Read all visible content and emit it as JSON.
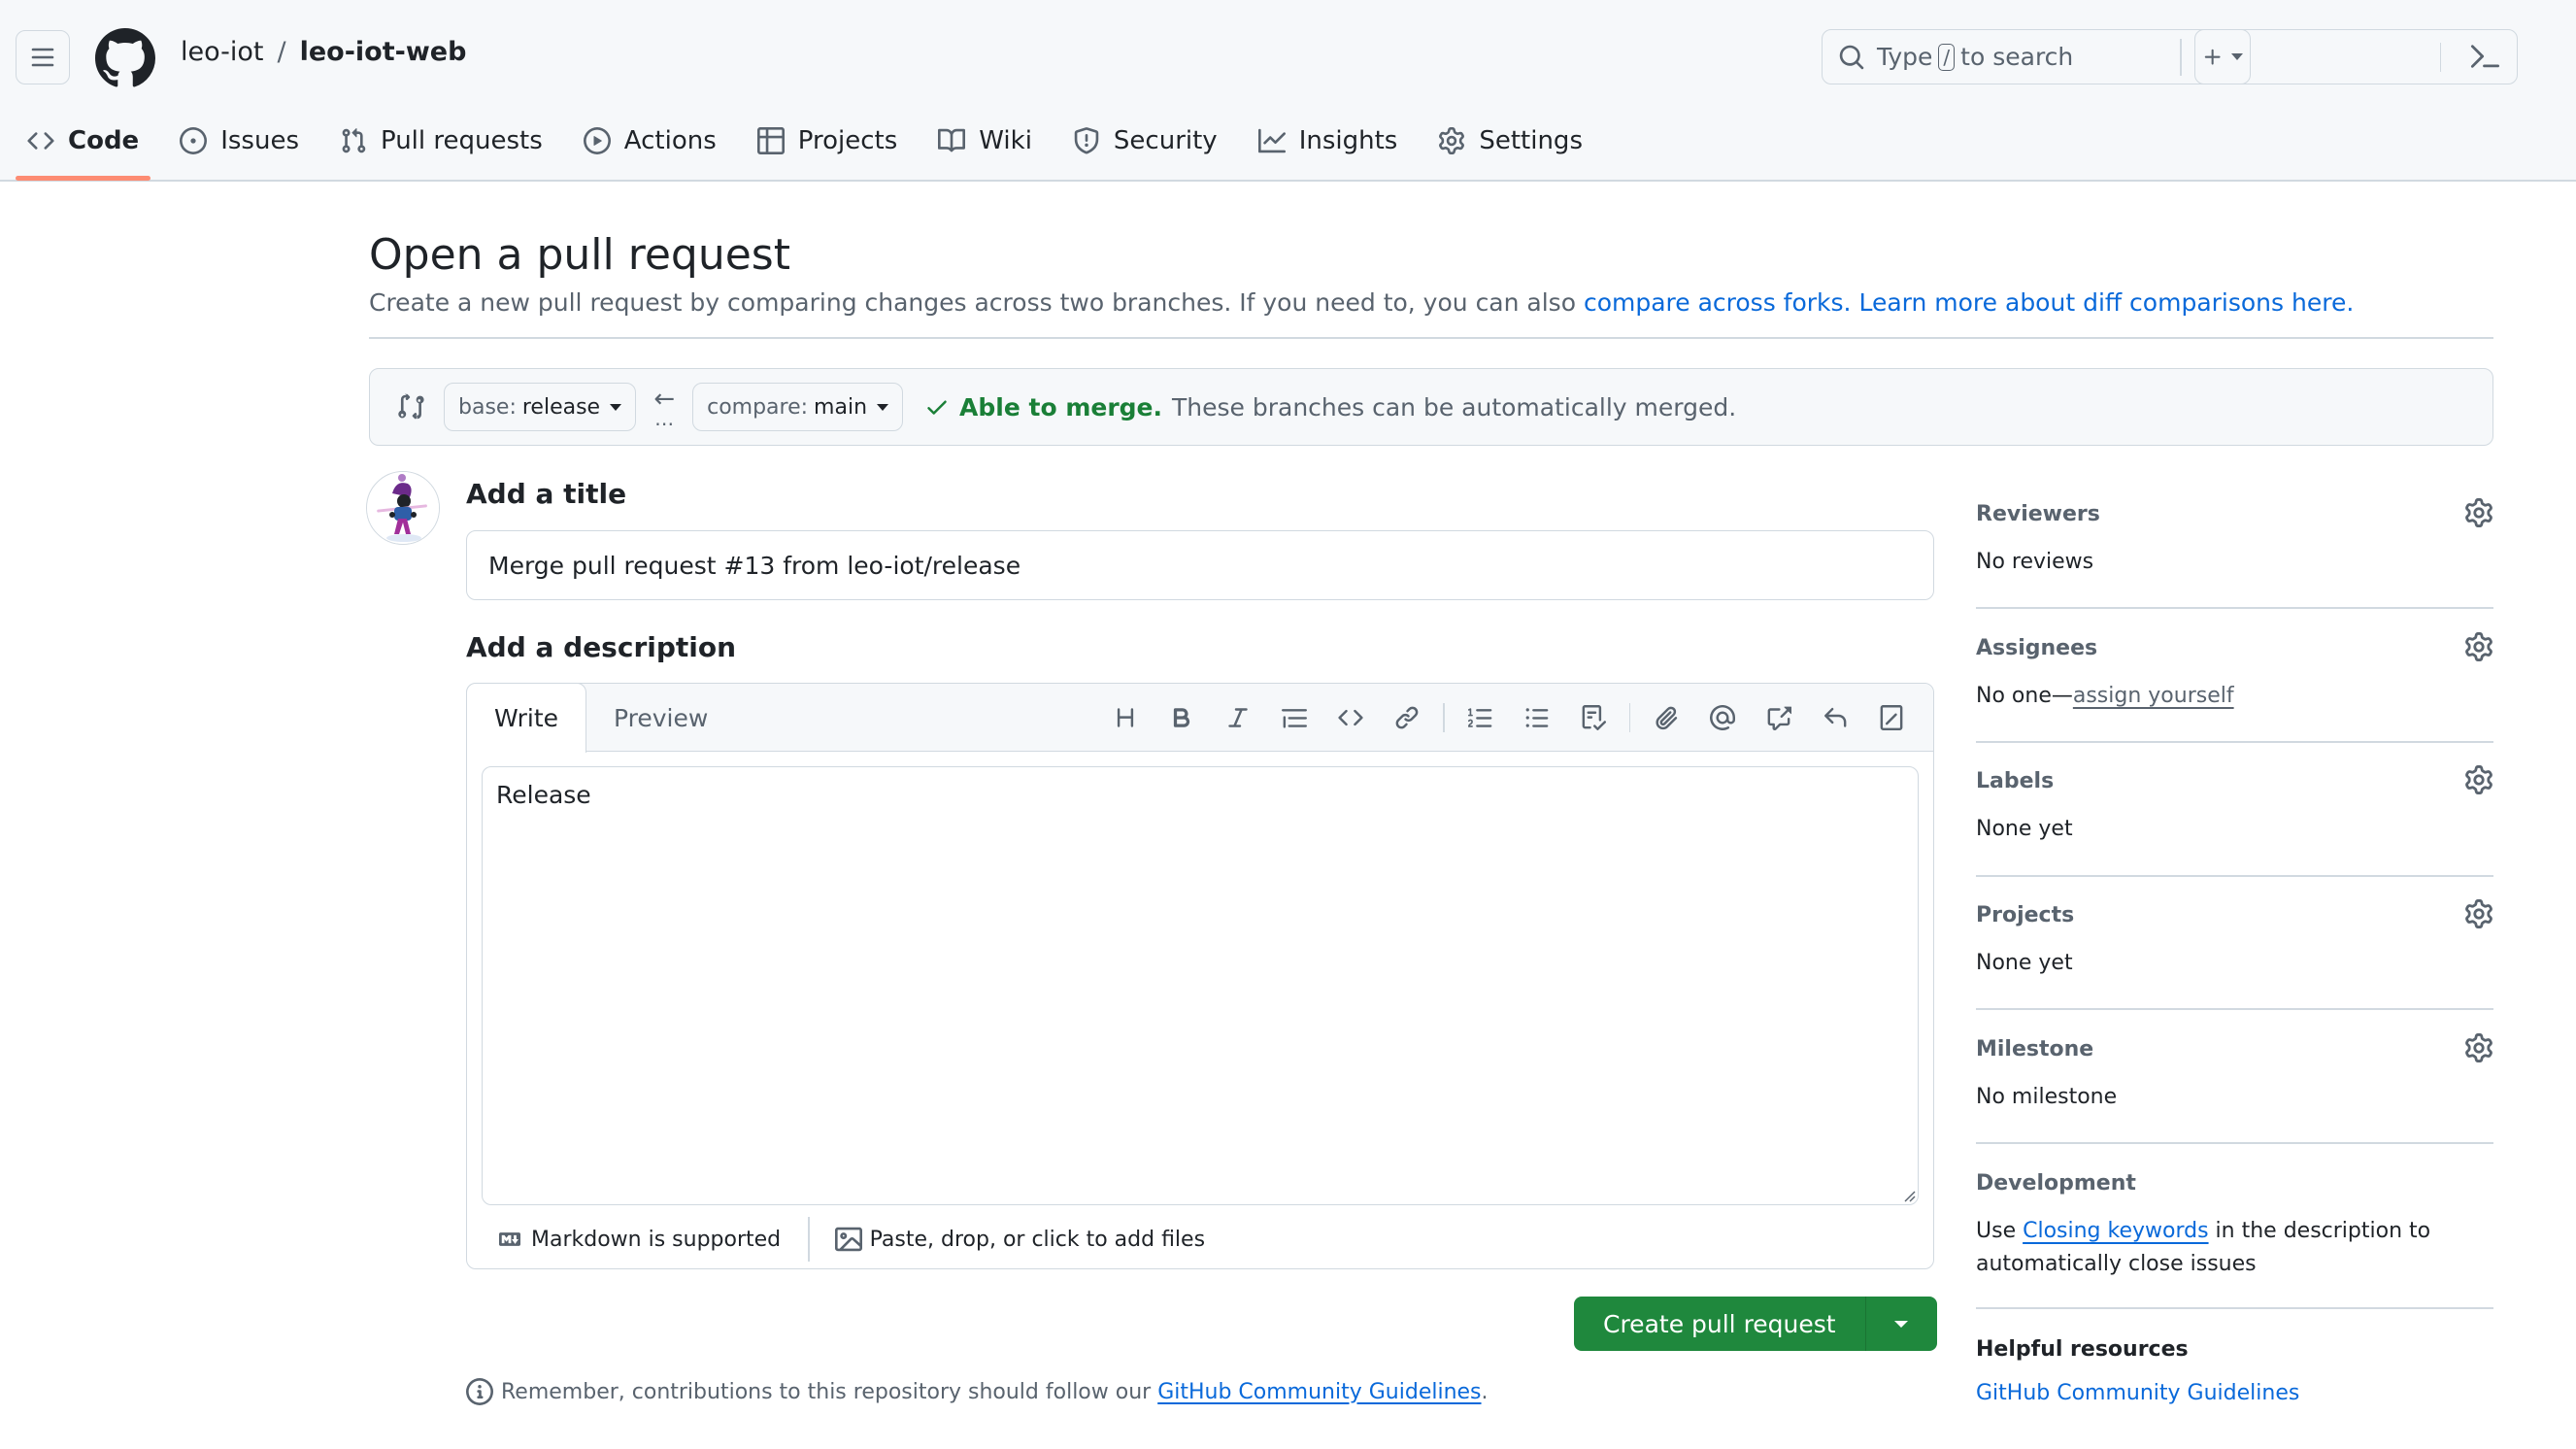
{
  "header": {
    "owner": "leo-iot",
    "separator": "/",
    "repo": "leo-iot-web",
    "search_prefix": "Type",
    "search_key": "/",
    "search_suffix": "to search",
    "icons": {
      "menu": "hamburger-icon",
      "logo": "github-logo-icon",
      "search": "search-icon",
      "command": "command-palette-icon",
      "create": "plus-icon"
    }
  },
  "repo_nav": {
    "tabs": [
      {
        "label": "Code",
        "icon": "code-icon",
        "active": true
      },
      {
        "label": "Issues",
        "icon": "issue-icon",
        "active": false
      },
      {
        "label": "Pull requests",
        "icon": "pull-request-icon",
        "active": false
      },
      {
        "label": "Actions",
        "icon": "play-icon",
        "active": false
      },
      {
        "label": "Projects",
        "icon": "table-icon",
        "active": false
      },
      {
        "label": "Wiki",
        "icon": "book-icon",
        "active": false
      },
      {
        "label": "Security",
        "icon": "shield-icon",
        "active": false
      },
      {
        "label": "Insights",
        "icon": "graph-icon",
        "active": false
      },
      {
        "label": "Settings",
        "icon": "gear-icon",
        "active": false
      }
    ],
    "accent_color": "#fd8c73"
  },
  "page": {
    "title": "Open a pull request",
    "subtitle_text": "Create a new pull request by comparing changes across two branches. If you need to, you can also ",
    "subtitle_link1": "compare across forks.",
    "subtitle_link2": "Learn more about diff comparisons here."
  },
  "compare": {
    "base_prefix": "base:",
    "base_branch": "release",
    "compare_prefix": "compare:",
    "compare_branch": "main",
    "status_bold": "Able to merge.",
    "status_text": "These branches can be automatically merged.",
    "status_color": "#1a7f37"
  },
  "form": {
    "title_label": "Add a title",
    "title_value": "Merge pull request #13 from leo-iot/release",
    "description_label": "Add a description",
    "tabs": {
      "write": "Write",
      "preview": "Preview"
    },
    "toolbar": [
      "heading-icon",
      "bold-icon",
      "italic-icon",
      "quote-icon",
      "code-icon",
      "link-icon",
      "|",
      "ordered-list-icon",
      "unordered-list-icon",
      "task-list-icon",
      "|",
      "attach-icon",
      "mention-icon",
      "cross-reference-icon",
      "reply-icon",
      "slash-command-icon"
    ],
    "description_value": "Release",
    "markdown_note": "Markdown is supported",
    "attach_note": "Paste, drop, or click to add files",
    "submit_label": "Create pull request",
    "submit_color": "#1f883d",
    "contrib_text": "Remember, contributions to this repository should follow our ",
    "contrib_link": "GitHub Community Guidelines",
    "contrib_end": "."
  },
  "sidebar": {
    "reviewers": {
      "label": "Reviewers",
      "value": "No reviews"
    },
    "assignees": {
      "label": "Assignees",
      "value_prefix": "No one—",
      "value_link": "assign yourself"
    },
    "labels": {
      "label": "Labels",
      "value": "None yet"
    },
    "projects": {
      "label": "Projects",
      "value": "None yet"
    },
    "milestone": {
      "label": "Milestone",
      "value": "No milestone"
    },
    "development": {
      "label": "Development",
      "prefix": "Use ",
      "link": "Closing keywords",
      "suffix": " in the description to automatically close issues"
    },
    "helpful": {
      "label": "Helpful resources",
      "link": "GitHub Community Guidelines"
    }
  }
}
